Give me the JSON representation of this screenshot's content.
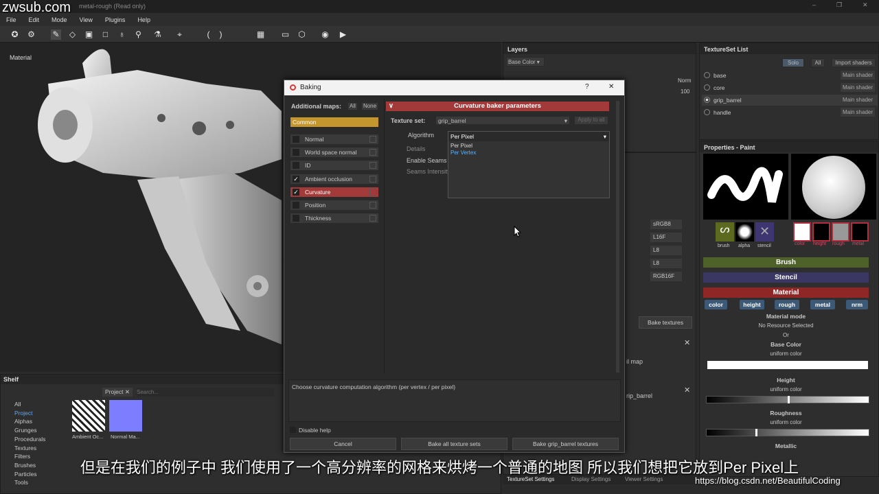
{
  "watermark_top": "zwsub.com",
  "window_title": "metal-rough (Read only)",
  "menu": [
    "File",
    "Edit",
    "Mode",
    "View",
    "Plugins",
    "Help"
  ],
  "viewport": {
    "label": "Material"
  },
  "layers": {
    "title": "Layers",
    "channel": "Base Color",
    "blend_label": "Norm",
    "opacity": "100"
  },
  "dialog": {
    "title": "Baking",
    "help_btn": "?",
    "close_btn": "✕",
    "additional_maps_label": "Additional maps:",
    "all_btn": "All",
    "none_btn": "None",
    "maps": [
      {
        "label": "Common",
        "checked": false
      },
      {
        "label": "Normal",
        "checked": false
      },
      {
        "label": "World space normal",
        "checked": false
      },
      {
        "label": "ID",
        "checked": false
      },
      {
        "label": "Ambient occlusion",
        "checked": true
      },
      {
        "label": "Curvature",
        "checked": true
      },
      {
        "label": "Position",
        "checked": false
      },
      {
        "label": "Thickness",
        "checked": false
      }
    ],
    "params_header": "Curvature baker parameters",
    "texture_set_label": "Texture set:",
    "texture_set_value": "grip_barrel",
    "apply_to_all": "Apply to all",
    "algorithm_label": "Algorithm",
    "algorithm_value": "Per Pixel",
    "algorithm_options": [
      "Per Pixel",
      "Per Vertex"
    ],
    "details_label": "Details",
    "enable_seams_label": "Enable Seams",
    "seams_intensity_label": "Seams Intensity",
    "help_text": "Choose curvature computation algorithm (per vertex / per pixel)",
    "disable_help": "Disable help",
    "cancel": "Cancel",
    "bake_all": "Bake all texture sets",
    "bake_one": "Bake grip_barrel textures"
  },
  "mid_panel": {
    "formats": [
      "sRGB8",
      "L16F",
      "L8",
      "L8",
      "RGB16F"
    ],
    "bake_textures": "Bake textures",
    "frag1": "il map",
    "frag2": "rip_barrel",
    "frag3": "p",
    "frag4": "p"
  },
  "textureset_list": {
    "title": "TextureSet List",
    "solo": "Solo",
    "all": "All",
    "import_shaders": "Import shaders",
    "sets": [
      {
        "name": "base",
        "shader": "Main shader",
        "selected": false
      },
      {
        "name": "core",
        "shader": "Main shader",
        "selected": false
      },
      {
        "name": "grip_barrel",
        "shader": "Main shader",
        "selected": true
      },
      {
        "name": "handle",
        "shader": "Main shader",
        "selected": false
      }
    ]
  },
  "properties": {
    "title": "Properties - Paint",
    "thumbs": [
      "brush",
      "alpha",
      "stencil"
    ],
    "mat_thumbs": [
      "color",
      "height",
      "rough",
      "metal"
    ],
    "brush": "Brush",
    "stencil": "Stencil",
    "material": "Material",
    "chips": [
      "color",
      "height",
      "rough",
      "metal",
      "nrm"
    ],
    "material_mode": "Material mode",
    "no_resource": "No Resource Selected",
    "or": "Or",
    "base_color": "Base Color",
    "uniform": "uniform color",
    "height": "Height",
    "roughness": "Roughness",
    "metallic": "Metallic",
    "height_value": 0.5,
    "roughness_value": 0.3,
    "colors": {
      "brush": "#5a6e2a",
      "stencil": "#3c3a66",
      "material": "#9b2a2a",
      "chip": "#3c5a78"
    }
  },
  "shelf": {
    "title": "Shelf",
    "categories": [
      "All",
      "Project",
      "Alphas",
      "Grunges",
      "Procedurals",
      "Textures",
      "Filters",
      "Brushes",
      "Particles",
      "Tools"
    ],
    "tab": "Project",
    "search_placeholder": "Search...",
    "items": [
      "Ambient Oc...",
      "Normal Ma..."
    ]
  },
  "bottom_tabs": [
    "TextureSet Settings",
    "Display Settings",
    "Viewer Settings"
  ],
  "subtitle": "但是在我们的例子中  我们使用了一个高分辨率的网格来烘烤一个普通的地图  所以我们想把它放到Per Pixel上",
  "watermark_bottom": "https://blog.csdn.net/BeautifulCoding"
}
